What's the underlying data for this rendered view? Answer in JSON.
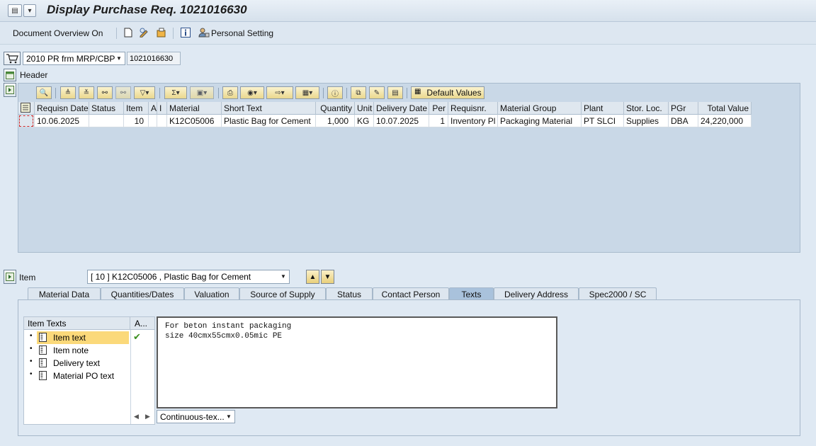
{
  "window": {
    "title": "Display Purchase Req. 1021016630"
  },
  "app_toolbar": {
    "doc_overview": "Document Overview On",
    "personal_setting": "Personal Setting"
  },
  "doc": {
    "type_value": "2010 PR frm MRP/CBP",
    "number": "1021016630"
  },
  "header_label": "Header",
  "grid": {
    "default_values_label": "Default Values",
    "columns": [
      "Requisn Date",
      "Status",
      "Item",
      "A",
      "I",
      "Material",
      "Short Text",
      "Quantity",
      "Unit",
      "Delivery Date",
      "Per",
      "Requisnr.",
      "Material Group",
      "Plant",
      "Stor. Loc.",
      "PGr",
      "Total Value"
    ],
    "row": [
      "10.06.2025",
      "",
      "10",
      "",
      "",
      "K12C05006",
      "Plastic Bag for Cement",
      "1,000",
      "KG",
      "10.07.2025",
      "1",
      "Inventory Pl",
      "Packaging Material",
      "PT SLCI",
      "Supplies",
      "DBA",
      "24,220,000"
    ]
  },
  "item": {
    "label": "Item",
    "selected": "[ 10 ] K12C05006 , Plastic Bag for Cement"
  },
  "tabs": [
    "Material Data",
    "Quantities/Dates",
    "Valuation",
    "Source of Supply",
    "Status",
    "Contact Person",
    "Texts",
    "Delivery Address",
    "Spec2000 / SC"
  ],
  "active_tab": "Texts",
  "texts": {
    "tree_header": "Item Texts",
    "tree_header2": "A...",
    "items": [
      "Item text",
      "Item note",
      "Delivery text",
      "Material PO text"
    ],
    "content": "For beton instant packaging\nsize 40cmx55cmx0.05mic PE",
    "format_combo": "Continuous-tex..."
  },
  "colors": {
    "accent": "#a9c2dc",
    "selection": "#fbd97a",
    "check": "#3a8f1e"
  }
}
